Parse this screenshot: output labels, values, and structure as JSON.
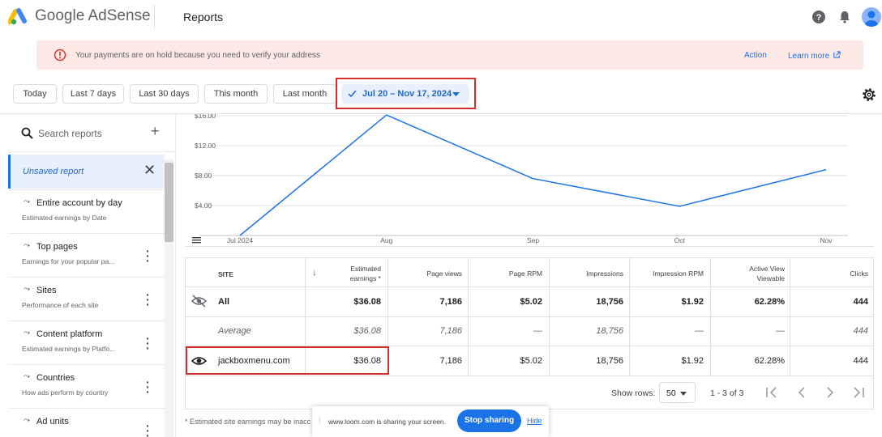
{
  "app": {
    "brand": "Google AdSense",
    "page_title": "Reports"
  },
  "alert": {
    "message": "Your payments are on hold because you need to verify your address",
    "action_label": "Action",
    "learn_more_label": "Learn more"
  },
  "date_filters": {
    "today": "Today",
    "last7": "Last 7 days",
    "last30": "Last 30 days",
    "this_month": "This month",
    "last_month": "Last month",
    "selected_range": "Jul 20 – Nov 17, 2024"
  },
  "sidebar": {
    "search_placeholder": "Search reports",
    "unsaved_label": "Unsaved report",
    "items": [
      {
        "title": "Entire account by day",
        "subtitle": "Estimated earnings by Date"
      },
      {
        "title": "Top pages",
        "subtitle": "Earnings for your popular pa..."
      },
      {
        "title": "Sites",
        "subtitle": "Performance of each site"
      },
      {
        "title": "Content platform",
        "subtitle": "Estimated earnings by Platfo..."
      },
      {
        "title": "Countries",
        "subtitle": "How ads perform by country"
      },
      {
        "title": "Ad units",
        "subtitle": ""
      }
    ]
  },
  "chart_data": {
    "type": "line",
    "x": [
      "Jul 2024",
      "Aug",
      "Sep",
      "Oct",
      "Nov"
    ],
    "x_tick_labels": [
      "Jul 2024",
      "Aug",
      "Sep",
      "Oct",
      "Nov"
    ],
    "y_tick_labels": [
      "$4.00",
      "$8.00",
      "$12.00",
      "$16.00"
    ],
    "values": [
      0.0,
      16.1,
      7.6,
      3.9,
      8.8
    ],
    "ylim": [
      0,
      16
    ],
    "grid": true,
    "series_color": "#1a73e8"
  },
  "table": {
    "headers": {
      "site": "SITE",
      "earnings": "Estimated earnings *",
      "page_views": "Page views",
      "page_rpm": "Page RPM",
      "impressions": "Impressions",
      "impression_rpm": "Impression RPM",
      "active_view": "Active View Viewable",
      "clicks": "Clicks"
    },
    "rows": [
      {
        "site": "All",
        "earnings": "$36.08",
        "page_views": "7,186",
        "page_rpm": "$5.02",
        "impressions": "18,756",
        "impression_rpm": "$1.92",
        "active_view": "62.28%",
        "clicks": "444"
      },
      {
        "site": "Average",
        "earnings": "$36.08",
        "page_views": "7,186",
        "page_rpm": "—",
        "impressions": "18,756",
        "impression_rpm": "—",
        "active_view": "—",
        "clicks": "444"
      },
      {
        "site": "jackboxmenu.com",
        "earnings": "$36.08",
        "page_views": "7,186",
        "page_rpm": "$5.02",
        "impressions": "18,756",
        "impression_rpm": "$1.92",
        "active_view": "62.28%",
        "clicks": "444"
      }
    ],
    "show_rows_label": "Show rows:",
    "rows_per_page": "50",
    "pagination_text": "1 - 3 of 3"
  },
  "footer_note": "* Estimated site earnings may be inacc",
  "screen_share": {
    "message": "www.loom.com is sharing your screen.",
    "stop_label": "Stop sharing",
    "hide_label": "Hide"
  }
}
